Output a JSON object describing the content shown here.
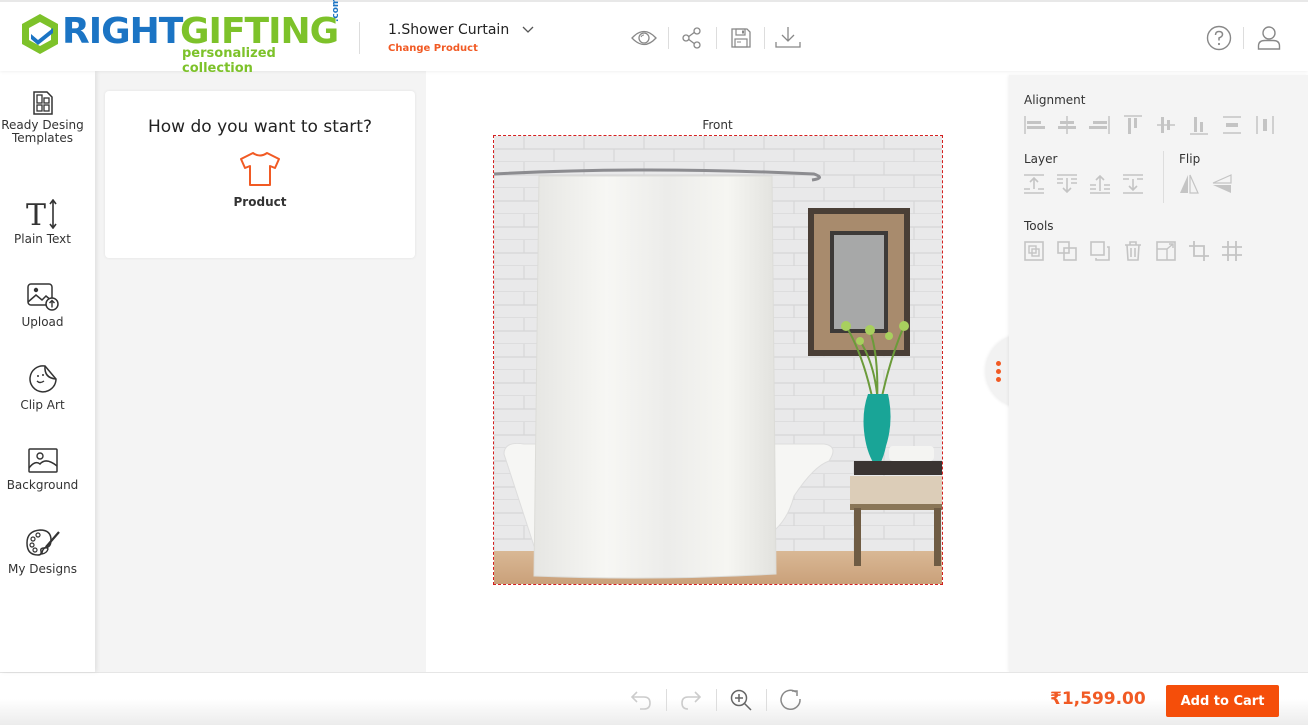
{
  "header": {
    "logo": {
      "word_right": "RIGHT",
      "word_gifting": "GIFTING",
      "com": ".com",
      "tagline": "personalized collection"
    },
    "product_title": "1.Shower Curtain",
    "change_product_label": "Change Product",
    "toolbar_icons": [
      "eye-icon",
      "share-icon",
      "save-icon",
      "download-icon"
    ],
    "right_icons": [
      "help-icon",
      "user-icon"
    ]
  },
  "sidebar": {
    "items": [
      {
        "label": "Ready Desing Templates",
        "icon": "template-icon"
      },
      {
        "label": "Plain Text",
        "icon": "text-icon"
      },
      {
        "label": "Upload",
        "icon": "upload-image-icon"
      },
      {
        "label": "Clip Art",
        "icon": "sticker-icon"
      },
      {
        "label": "Background",
        "icon": "image-icon"
      },
      {
        "label": "My Designs",
        "icon": "palette-icon"
      }
    ]
  },
  "start_panel": {
    "heading": "How do you want to start?",
    "option_label": "Product"
  },
  "canvas": {
    "side_label": "Front",
    "image_alt": "Shower curtain in bathroom"
  },
  "right_panel": {
    "alignment_title": "Alignment",
    "layer_title": "Layer",
    "flip_title": "Flip",
    "tools_title": "Tools"
  },
  "footer": {
    "price": "₹1,599.00",
    "add_to_cart_label": "Add to Cart"
  },
  "colors": {
    "accent": "#f15a24",
    "button": "#f54e0a",
    "logo_blue": "#1b74c4",
    "logo_green": "#7dc22a",
    "icon_disabled": "#c4c4c4"
  }
}
